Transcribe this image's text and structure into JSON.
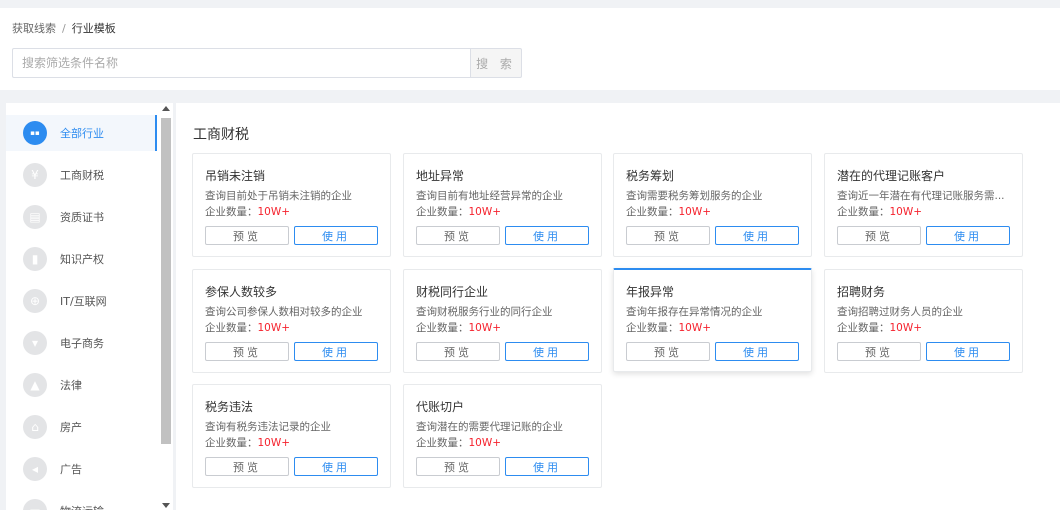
{
  "breadcrumb": {
    "parent": "获取线索",
    "separator": "/",
    "current": "行业模板"
  },
  "search": {
    "placeholder": "搜索筛选条件名称",
    "button_label": "搜 索"
  },
  "sidebar": {
    "items": [
      {
        "label": "全部行业",
        "icon": "grid-icon",
        "active": true
      },
      {
        "label": "工商财税",
        "icon": "yen-icon"
      },
      {
        "label": "资质证书",
        "icon": "certificate-icon"
      },
      {
        "label": "知识产权",
        "icon": "book-icon"
      },
      {
        "label": "IT/互联网",
        "icon": "globe-icon"
      },
      {
        "label": "电子商务",
        "icon": "cart-icon"
      },
      {
        "label": "法律",
        "icon": "gavel-icon"
      },
      {
        "label": "房产",
        "icon": "home-icon"
      },
      {
        "label": "广告",
        "icon": "megaphone-icon"
      },
      {
        "label": "物流运输",
        "icon": "truck-icon"
      }
    ]
  },
  "main": {
    "section_title": "工商财税",
    "count_label": "企业数量：",
    "preview_label": "预览",
    "use_label": "使用",
    "cards": [
      {
        "title": "吊销未注销",
        "desc": "查询目前处于吊销未注销的企业",
        "count": "10W+"
      },
      {
        "title": "地址异常",
        "desc": "查询目前有地址经营异常的企业",
        "count": "10W+"
      },
      {
        "title": "税务筹划",
        "desc": "查询需要税务筹划服务的企业",
        "count": "10W+"
      },
      {
        "title": "潜在的代理记账客户",
        "desc": "查询近一年潜在有代理记账服务需...",
        "count": "10W+"
      },
      {
        "title": "参保人数较多",
        "desc": "查询公司参保人数相对较多的企业",
        "count": "10W+"
      },
      {
        "title": "财税同行企业",
        "desc": "查询财税服务行业的同行企业",
        "count": "10W+"
      },
      {
        "title": "年报异常",
        "desc": "查询年报存在异常情况的企业",
        "count": "10W+",
        "highlight": true
      },
      {
        "title": "招聘财务",
        "desc": "查询招聘过财务人员的企业",
        "count": "10W+"
      },
      {
        "title": "税务违法",
        "desc": "查询有税务违法记录的企业",
        "count": "10W+"
      },
      {
        "title": "代账切户",
        "desc": "查询潜在的需要代理记账的企业",
        "count": "10W+"
      }
    ]
  },
  "colors": {
    "accent": "#2d8cf0",
    "count_red": "#f5222d",
    "background": "#f0f2f5"
  }
}
